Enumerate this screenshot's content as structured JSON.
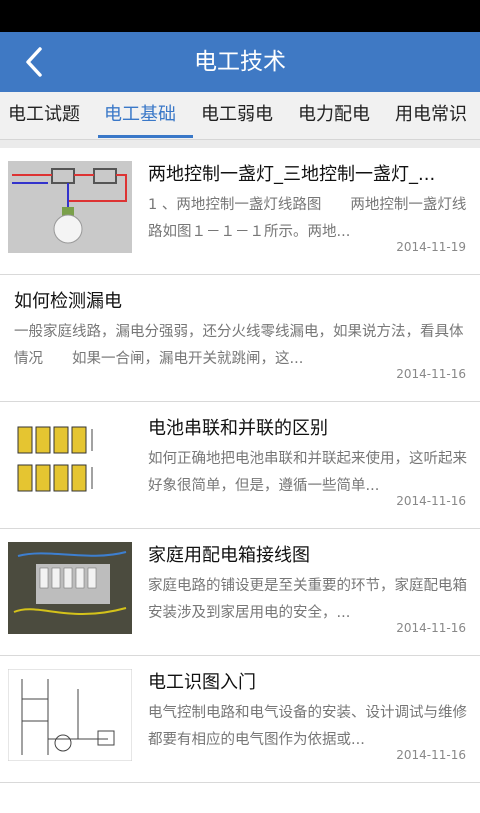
{
  "header": {
    "title": "电工技术"
  },
  "tabs": [
    {
      "label": "电工试题"
    },
    {
      "label": "电工基础"
    },
    {
      "label": "电工弱电"
    },
    {
      "label": "电力配电"
    },
    {
      "label": "用电常识"
    }
  ],
  "articles": [
    {
      "title": "两地控制一盏灯_三地控制一盏灯_...",
      "summary": "1 、两地控制一盏灯线路图　　两地控制一盏灯线路如图１－１－１所示。两地...",
      "date": "2014-11-19"
    },
    {
      "title": "如何检测漏电",
      "summary": "一般家庭线路，漏电分强弱，还分火线零线漏电，如果说方法，看具体情况　　如果一合闸，漏电开关就跳闸，这...",
      "date": "2014-11-16"
    },
    {
      "title": "电池串联和并联的区别",
      "summary": "如何正确地把电池串联和并联起来使用，这听起来好象很简单，但是，遵循一些简单...",
      "date": "2014-11-16"
    },
    {
      "title": "家庭用配电箱接线图",
      "summary": "家庭电路的铺设更是至关重要的环节，家庭配电箱安装涉及到家居用电的安全，...",
      "date": "2014-11-16"
    },
    {
      "title": "电工识图入门",
      "summary": "电气控制电路和电气设备的安装、设计调试与维修都要有相应的电气图作为依据或...",
      "date": "2014-11-16"
    }
  ],
  "colors": {
    "header": "#3f79c4",
    "tab_active": "#3a78c8"
  }
}
